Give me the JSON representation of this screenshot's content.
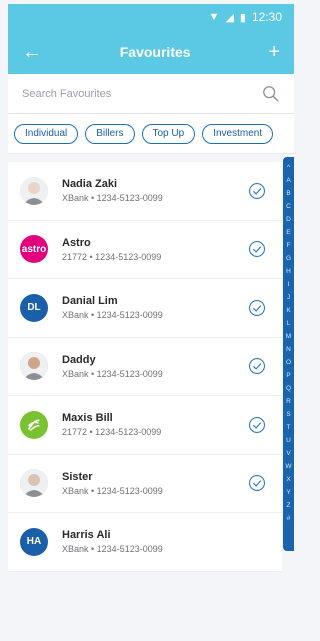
{
  "status": {
    "time": "12:30"
  },
  "header": {
    "title": "Favourites"
  },
  "search": {
    "placeholder": "Search Favourites"
  },
  "filters": [
    "Individual",
    "Billers",
    "Top Up",
    "Investment"
  ],
  "favourites": [
    {
      "name": "Nadia Zaki",
      "detail": "XBank • 1234-5123-0099",
      "avatar": {
        "type": "photo",
        "color": "#e9d6c7"
      }
    },
    {
      "name": "Astro",
      "detail": "21772 • 1234-5123-0099",
      "avatar": {
        "type": "logo",
        "text": "astro",
        "color": "#e3007d"
      }
    },
    {
      "name": "Danial Lim",
      "detail": "XBank • 1234-5123-0099",
      "avatar": {
        "type": "initials",
        "text": "DL",
        "color": "#1a5fa8"
      }
    },
    {
      "name": "Daddy",
      "detail": "XBank • 1234-5123-0099",
      "avatar": {
        "type": "photo",
        "color": "#cfa68c"
      }
    },
    {
      "name": "Maxis Bill",
      "detail": "21772 • 1234-5123-0099",
      "avatar": {
        "type": "logo",
        "text": "",
        "color": "#7ac231"
      }
    },
    {
      "name": "Sister",
      "detail": "XBank • 1234-5123-0099",
      "avatar": {
        "type": "photo",
        "color": "#d9c3b2"
      }
    },
    {
      "name": "Harris Ali",
      "detail": "XBank • 1234-5123-0099",
      "avatar": {
        "type": "initials",
        "text": "HA",
        "color": "#1a5fa8"
      }
    }
  ],
  "alphabet": [
    "^",
    "A",
    "B",
    "C",
    "D",
    "E",
    "F",
    "G",
    "H",
    "I",
    "J",
    "K",
    "L",
    "M",
    "N",
    "O",
    "P",
    "Q",
    "R",
    "S",
    "T",
    "U",
    "V",
    "W",
    "X",
    "Y",
    "Z",
    "#"
  ],
  "colors": {
    "header": "#5bc8e4",
    "accent": "#1a5fa8",
    "index_bar": "#1a63ad"
  }
}
